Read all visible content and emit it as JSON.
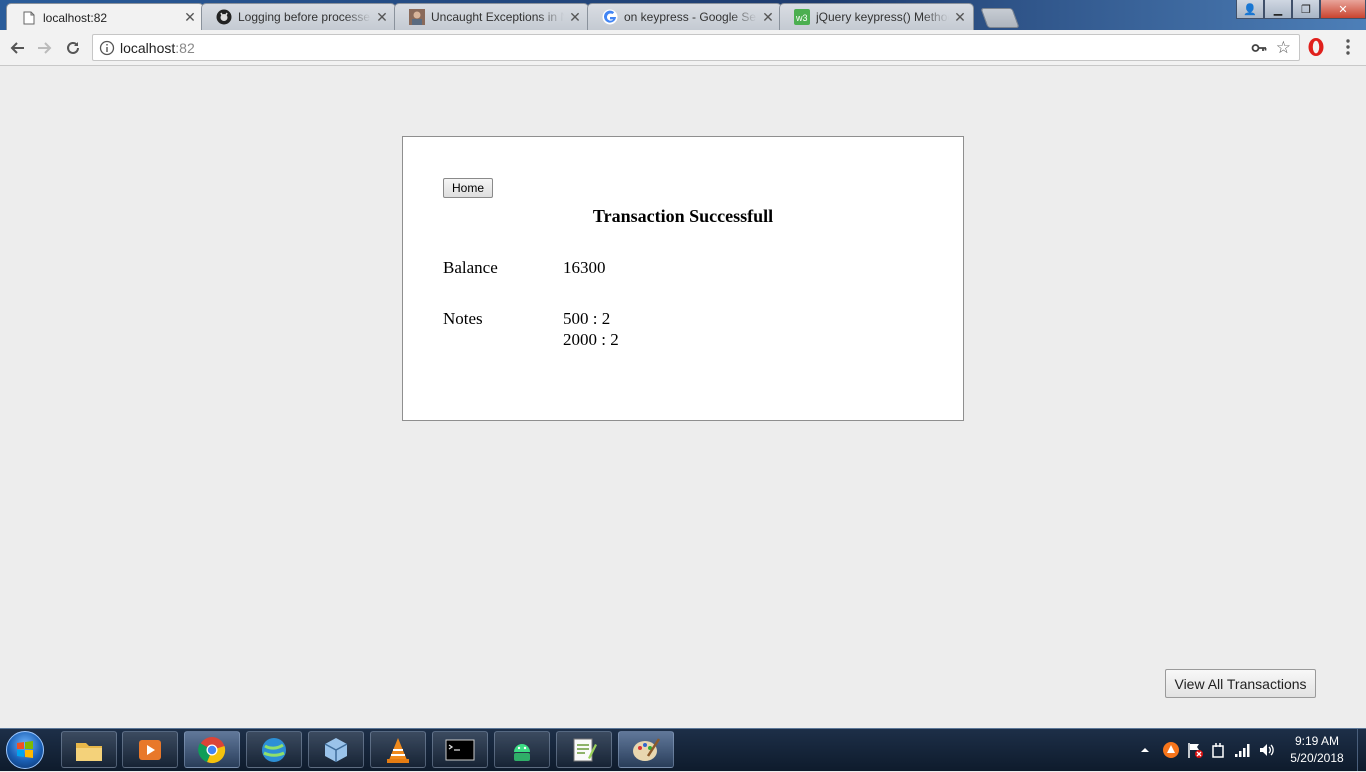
{
  "browser": {
    "tabs": [
      {
        "label": "localhost:82",
        "icon": "page-icon",
        "active": true
      },
      {
        "label": "Logging before processe",
        "icon": "github-icon",
        "active": false
      },
      {
        "label": "Uncaught Exceptions in N",
        "icon": "avatar-icon",
        "active": false
      },
      {
        "label": "on keypress - Google Sea",
        "icon": "google-icon",
        "active": false
      },
      {
        "label": "jQuery keypress() Method",
        "icon": "w3schools-icon",
        "active": false
      }
    ],
    "tab_close_glyph": "✕",
    "window_controls": {
      "user": "👤",
      "minimize": "▁",
      "maximize": "❐",
      "close": "✕"
    },
    "address": {
      "host": "localhost",
      "port": ":82"
    },
    "star_glyph": "☆"
  },
  "page": {
    "home_label": "Home",
    "title": "Transaction Successfull",
    "balance_label": "Balance",
    "balance_value": "16300",
    "notes_label": "Notes",
    "notes": [
      "500 : 2",
      "2000 : 2"
    ],
    "view_all_label": "View All Transactions"
  },
  "taskbar": {
    "apps": [
      "file-explorer",
      "media-player",
      "chrome",
      "network-app",
      "box-app",
      "vlc",
      "terminal",
      "android-app",
      "notepad-plus",
      "paint"
    ],
    "time": "9:19 AM",
    "date": "5/20/2018"
  },
  "colors": {
    "page_bg": "#ededed",
    "card_bg": "#ffffff",
    "taskbar": "#13233a"
  }
}
